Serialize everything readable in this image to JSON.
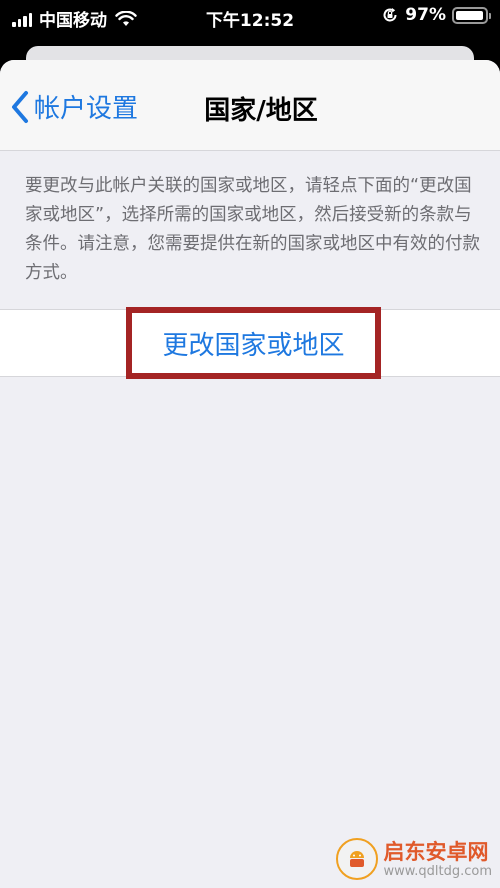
{
  "status_bar": {
    "carrier": "中国移动",
    "time": "下午12:52",
    "battery_percent": "97%",
    "battery_level": 0.97,
    "icons": [
      "signal-icon",
      "wifi-icon",
      "orientation-lock-icon",
      "battery-icon"
    ]
  },
  "nav": {
    "back_label": "帐户设置",
    "title": "国家/地区"
  },
  "description": "要更改与此帐户关联的国家或地区，请轻点下面的“更改国家或地区”，选择所需的国家或地区，然后接受新的条款与条件。请注意，您需要提供在新的国家或地区中有效的付款方式。",
  "action": {
    "change_label": "更改国家或地区"
  },
  "watermark": {
    "name": "启东安卓网",
    "url": "www.qdltdg.com"
  },
  "colors": {
    "accent": "#1e78e0",
    "highlight_border": "#a42424",
    "background": "#efeff4"
  }
}
